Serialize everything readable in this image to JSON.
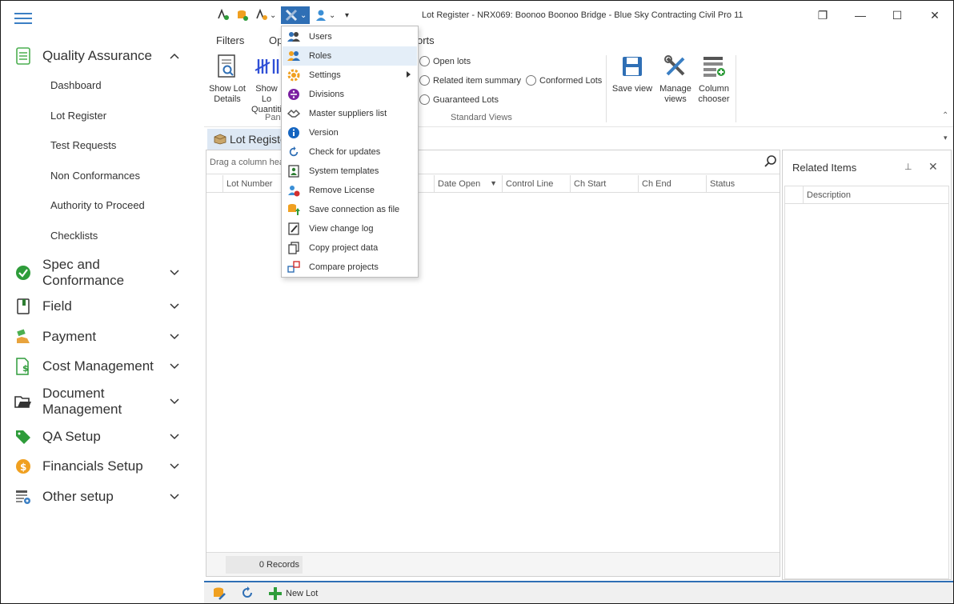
{
  "window": {
    "title": "Lot Register - NRX069: Boonoo Boonoo Bridge  - Blue Sky Contracting Civil Pro 11",
    "restore_symbol": "❐",
    "minimize_symbol": "—",
    "maximize_symbol": "☐",
    "close_symbol": "✕"
  },
  "sidebar": {
    "groups": [
      {
        "label": "Quality Assurance",
        "icon": "checklist-icon",
        "color": "#4caf50",
        "expanded": true,
        "items": [
          "Dashboard",
          "Lot Register",
          "Test Requests",
          "Non Conformances",
          "Authority to Proceed",
          "Checklists"
        ]
      },
      {
        "label": "Spec and Conformance",
        "icon": "checkmark-circle-icon",
        "color": "#2e9c3a"
      },
      {
        "label": "Field",
        "icon": "notebook-icon",
        "color": "#2e7d32"
      },
      {
        "label": "Payment",
        "icon": "payment-hand-icon",
        "color": "#e8a33d"
      },
      {
        "label": "Cost Management",
        "icon": "dollar-document-icon",
        "color": "#2e9c3a"
      },
      {
        "label": "Document Management",
        "icon": "folder-icon",
        "color": "#333333"
      },
      {
        "label": "QA Setup",
        "icon": "tag-icon",
        "color": "#2e9c3a"
      },
      {
        "label": "Financials Setup",
        "icon": "dollar-coin-icon",
        "color": "#f0a020"
      },
      {
        "label": "Other setup",
        "icon": "table-gear-icon",
        "color": "#3b7fc4"
      }
    ]
  },
  "ribbon": {
    "tabs": [
      "Filters",
      "Op",
      "orts"
    ],
    "buttons": {
      "show_lot_details": "Show Lot Details",
      "show_lot_quantities": "Show Lo Quantiti",
      "save_view": "Save view",
      "manage_views": "Manage views",
      "column_chooser": "Column chooser"
    },
    "group_labels": {
      "panels": "Pan",
      "standard_views": "Standard Views"
    },
    "views": [
      "Open lots",
      "Related item summary",
      "Conformed Lots",
      "Guaranteed Lots"
    ]
  },
  "doc_tab": {
    "label": "Lot Registe"
  },
  "grid": {
    "group_hint": "Drag a column hea",
    "columns": [
      "Lot Number",
      "Date Open",
      "Control Line",
      "Ch Start",
      "Ch End",
      "Status"
    ],
    "records": "0 Records"
  },
  "related": {
    "title": "Related Items",
    "pin_symbol": "⊥",
    "close_symbol": "✕",
    "column": "Description"
  },
  "statusbar": {
    "new_lot": "New Lot"
  },
  "menu": {
    "items": [
      {
        "label": "Users",
        "icon": "users-icon"
      },
      {
        "label": "Roles",
        "icon": "roles-icon"
      },
      {
        "label": "Settings",
        "icon": "settings-gear-icon",
        "submenu": true
      },
      {
        "label": "Divisions",
        "icon": "divisions-icon"
      },
      {
        "label": "Master suppliers list",
        "icon": "handshake-icon"
      },
      {
        "label": "Version",
        "icon": "info-icon"
      },
      {
        "label": "Check for updates",
        "icon": "refresh-icon"
      },
      {
        "label": "System templates",
        "icon": "template-icon"
      },
      {
        "label": "Remove License",
        "icon": "remove-license-icon"
      },
      {
        "label": "Save connection as file",
        "icon": "save-connection-icon"
      },
      {
        "label": "View change log",
        "icon": "change-log-icon"
      },
      {
        "label": "Copy project data",
        "icon": "copy-icon"
      },
      {
        "label": "Compare projects",
        "icon": "compare-icon"
      }
    ],
    "hover_index": 1
  },
  "colors": {
    "accent": "#2f6fb5",
    "hover": "#e4eef8",
    "doc_tab": "#dde8f4"
  }
}
